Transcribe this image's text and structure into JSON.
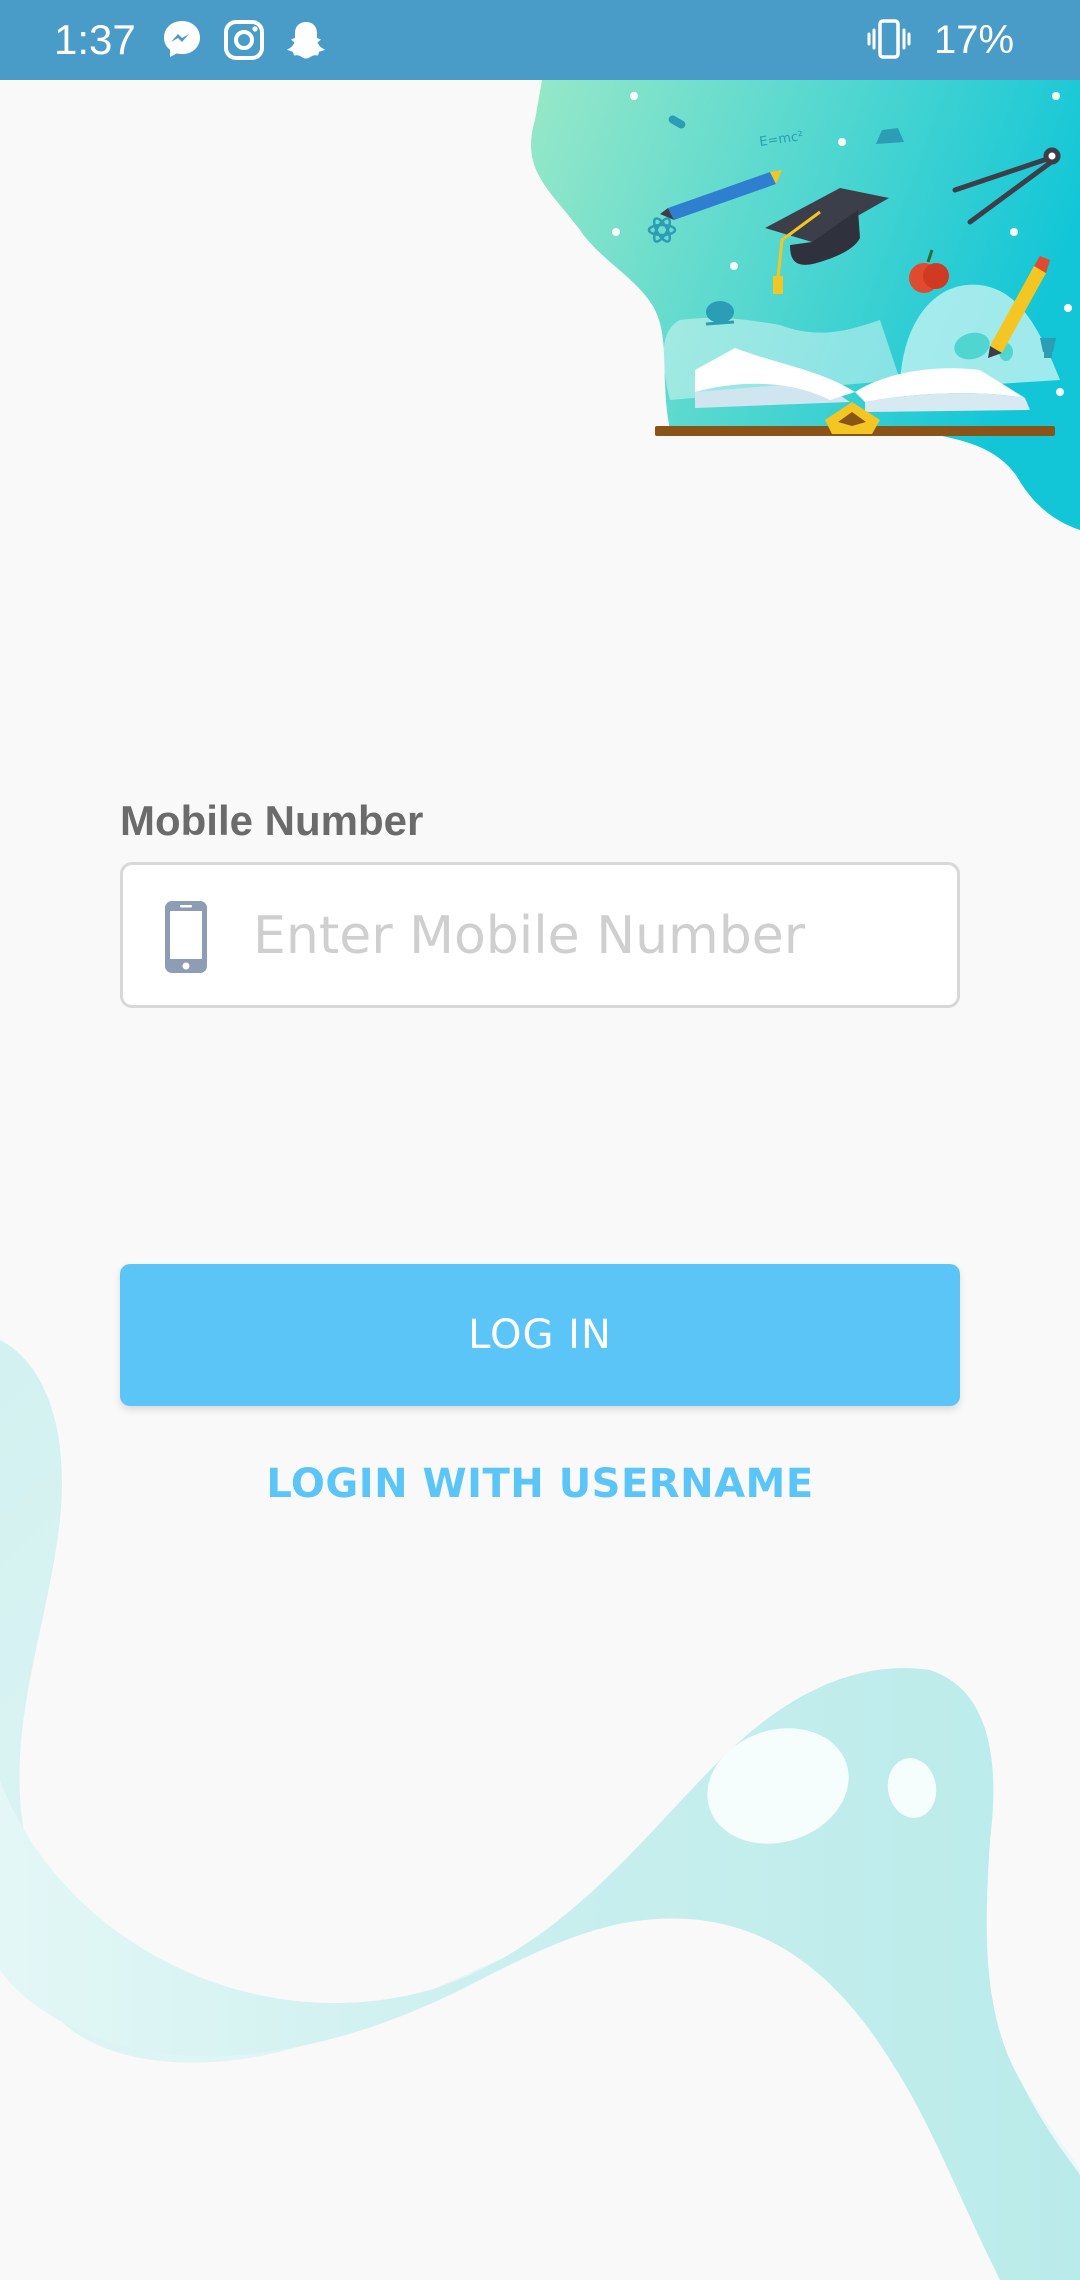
{
  "status_bar": {
    "time": "1:37",
    "battery": "17%",
    "icons": [
      "messenger-icon",
      "instagram-icon",
      "snapchat-icon",
      "vibrate-icon"
    ],
    "background": "#4a9cc8"
  },
  "header_illustration": {
    "icons": [
      "graduation-cap-icon",
      "pencil-icon",
      "compass-icon",
      "apple-icon",
      "open-book-icon",
      "atom-icon",
      "palette-icon",
      "trophy-icon"
    ]
  },
  "login": {
    "mobile_label": "Mobile Number",
    "mobile_placeholder": "Enter Mobile Number",
    "mobile_value": "",
    "login_button": "LOG IN",
    "username_link": "LOGIN WITH USERNAME"
  },
  "colors": {
    "accent": "#5bc5f8",
    "label": "#6b6b6b",
    "wave": "#bdeeed"
  }
}
